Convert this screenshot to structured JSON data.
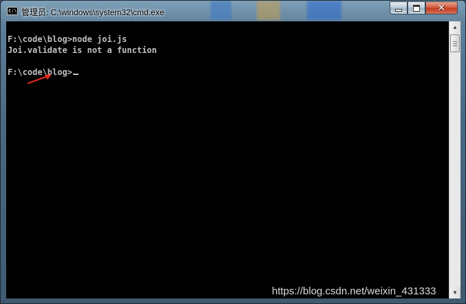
{
  "window": {
    "app_icon_text": "C:\\",
    "title": "管理员: C:\\windows\\system32\\cmd.exe",
    "controls": {
      "minimize_icon": "minimize-icon",
      "maximize_icon": "maximize-icon",
      "close_icon": "close-icon",
      "close_glyph": "✕"
    }
  },
  "console": {
    "lines": [
      "F:\\code\\blog>node joi.js",
      "Joi.validate is not a function",
      "F:\\code\\blog>"
    ],
    "text_color": "#c0c0c0",
    "background": "#000000"
  },
  "annotation": {
    "arrow_color": "#e8281c"
  },
  "scrollbar": {
    "up_glyph": "▲",
    "down_glyph": "▼"
  },
  "watermark": "https://blog.csdn.net/weixin_431333"
}
